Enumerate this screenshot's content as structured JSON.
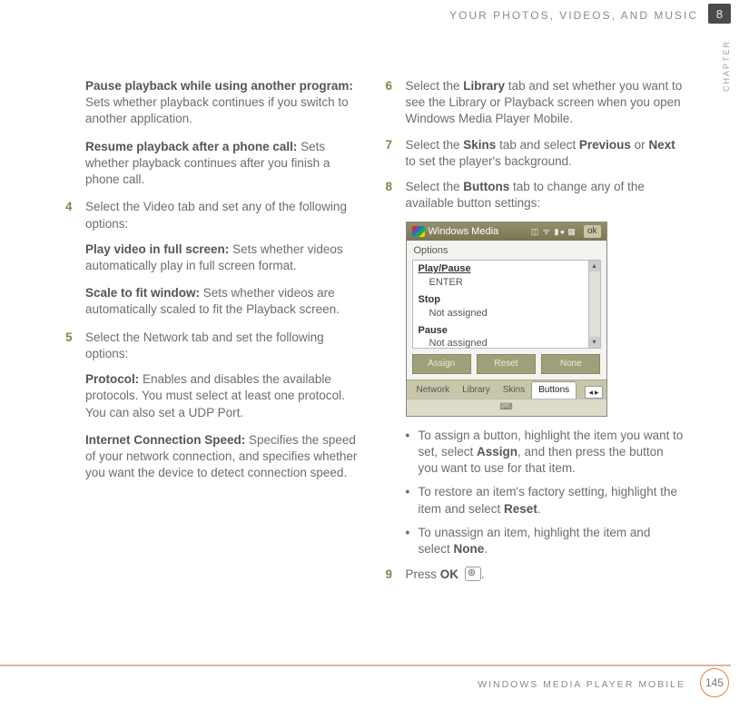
{
  "header": "YOUR PHOTOS, VIDEOS, AND MUSIC",
  "chapterNumber": "8",
  "chapterLabel": "CHAPTER",
  "footerLabel": "WINDOWS MEDIA PLAYER MOBILE",
  "pageNumber": "145",
  "left": {
    "pausePlayback": {
      "title": "Pause playback while using another program:",
      "body": " Sets whether playback continues if you switch to another application."
    },
    "resume": {
      "title": "Resume playback after a phone call:",
      "body": " Sets whether playback continues after you finish a phone call."
    },
    "step4": {
      "num": "4",
      "text": "Select the Video tab and set any of the following options:"
    },
    "playFull": {
      "title": "Play video in full screen:",
      "body": " Sets whether videos automatically play in full screen format."
    },
    "scale": {
      "title": "Scale to fit window:",
      "body": " Sets whether videos are automatically scaled to fit the Playback screen."
    },
    "step5": {
      "num": "5",
      "text": "Select the Network tab and set the following options:"
    },
    "protocol": {
      "title": "Protocol:",
      "body": " Enables and disables the available protocols. You must select at least one protocol. You can also set a UDP Port."
    },
    "speed": {
      "title": "Internet Connection Speed:",
      "body": " Specifies the speed of your network connection, and specifies whether you want the device to detect connection speed."
    }
  },
  "right": {
    "step6": {
      "num": "6",
      "pre": "Select the ",
      "strong1": "Library",
      "post": " tab and set whether you want to see the Library or Playback screen when you open Windows Media Player Mobile."
    },
    "step7": {
      "num": "7",
      "pre": "Select the ",
      "strong1": "Skins",
      "mid": " tab and select ",
      "strong2": "Previous",
      "or": " or ",
      "strong3": "Next",
      "post": " to set the player's background."
    },
    "step8": {
      "num": "8",
      "pre": "Select the ",
      "strong1": "Buttons",
      "post": " tab to change any of the available button settings:"
    },
    "bullets": {
      "b1": {
        "pre": "To assign a button, highlight the item you want to set, select ",
        "strong": "Assign",
        "post": ", and then press the button you want to use for that item."
      },
      "b2": {
        "pre": "To restore an item's factory setting, highlight the item and select ",
        "strong": "Reset",
        "post": "."
      },
      "b3": {
        "pre": "To unassign an item, highlight the item and select ",
        "strong": "None",
        "post": "."
      }
    },
    "step9": {
      "num": "9",
      "pre": "Press ",
      "strong": "OK",
      "post": " "
    }
  },
  "screenshot": {
    "titlebar": "Windows Media",
    "ok": "ok",
    "heading": "Options",
    "items": {
      "playPause": "Play/Pause",
      "playPauseSub": "ENTER",
      "stop": "Stop",
      "stopSub": "Not assigned",
      "pause": "Pause",
      "pauseSub": "Not assigned"
    },
    "buttons": {
      "assign": "Assign",
      "reset": "Reset",
      "none": "None"
    },
    "tabs": {
      "network": "Network",
      "library": "Library",
      "skins": "Skins",
      "buttons": "Buttons"
    },
    "kbd": "⌨"
  }
}
